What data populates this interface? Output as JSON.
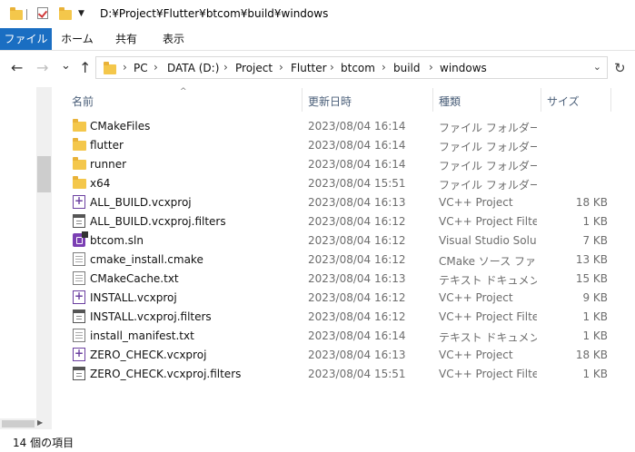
{
  "titlebar": {
    "path": "D:¥Project¥Flutter¥btcom¥build¥windows"
  },
  "ribbon": {
    "tabs": [
      "ファイル",
      "ホーム",
      "共有",
      "表示"
    ]
  },
  "nav": {
    "back": "←",
    "forward": "→",
    "recent": "⌄",
    "up": "↑",
    "refresh": "↻"
  },
  "address": {
    "crumbs": [
      "PC",
      "DATA (D:)",
      "Project",
      "Flutter",
      "btcom",
      "build",
      "windows"
    ],
    "separator": "›"
  },
  "columns": {
    "name": "名前",
    "date": "更新日時",
    "type": "種類",
    "size": "サイズ"
  },
  "files": [
    {
      "name": "CMakeFiles",
      "date": "2023/08/04 16:14",
      "type": "ファイル フォルダー",
      "size": "",
      "icon": "folder"
    },
    {
      "name": "flutter",
      "date": "2023/08/04 16:14",
      "type": "ファイル フォルダー",
      "size": "",
      "icon": "folder"
    },
    {
      "name": "runner",
      "date": "2023/08/04 16:14",
      "type": "ファイル フォルダー",
      "size": "",
      "icon": "folder"
    },
    {
      "name": "x64",
      "date": "2023/08/04 15:51",
      "type": "ファイル フォルダー",
      "size": "",
      "icon": "folder"
    },
    {
      "name": "ALL_BUILD.vcxproj",
      "date": "2023/08/04 16:13",
      "type": "VC++ Project",
      "size": "18 KB",
      "icon": "vcxproj"
    },
    {
      "name": "ALL_BUILD.vcxproj.filters",
      "date": "2023/08/04 16:12",
      "type": "VC++ Project Filte...",
      "size": "1 KB",
      "icon": "filters"
    },
    {
      "name": "btcom.sln",
      "date": "2023/08/04 16:12",
      "type": "Visual Studio Solu...",
      "size": "7 KB",
      "icon": "sln"
    },
    {
      "name": "cmake_install.cmake",
      "date": "2023/08/04 16:12",
      "type": "CMake ソース ファイル",
      "size": "13 KB",
      "icon": "doc"
    },
    {
      "name": "CMakeCache.txt",
      "date": "2023/08/04 16:13",
      "type": "テキスト ドキュメント",
      "size": "15 KB",
      "icon": "doc"
    },
    {
      "name": "INSTALL.vcxproj",
      "date": "2023/08/04 16:12",
      "type": "VC++ Project",
      "size": "9 KB",
      "icon": "vcxproj"
    },
    {
      "name": "INSTALL.vcxproj.filters",
      "date": "2023/08/04 16:12",
      "type": "VC++ Project Filte...",
      "size": "1 KB",
      "icon": "filters"
    },
    {
      "name": "install_manifest.txt",
      "date": "2023/08/04 16:14",
      "type": "テキスト ドキュメント",
      "size": "1 KB",
      "icon": "doc"
    },
    {
      "name": "ZERO_CHECK.vcxproj",
      "date": "2023/08/04 16:13",
      "type": "VC++ Project",
      "size": "18 KB",
      "icon": "vcxproj"
    },
    {
      "name": "ZERO_CHECK.vcxproj.filters",
      "date": "2023/08/04 15:51",
      "type": "VC++ Project Filte...",
      "size": "1 KB",
      "icon": "filters"
    }
  ],
  "status": {
    "count_text": "14 個の項目"
  },
  "colors": {
    "accent": "#1a6ec2",
    "folder": "#f4c74b",
    "header_text": "#4c607a"
  }
}
